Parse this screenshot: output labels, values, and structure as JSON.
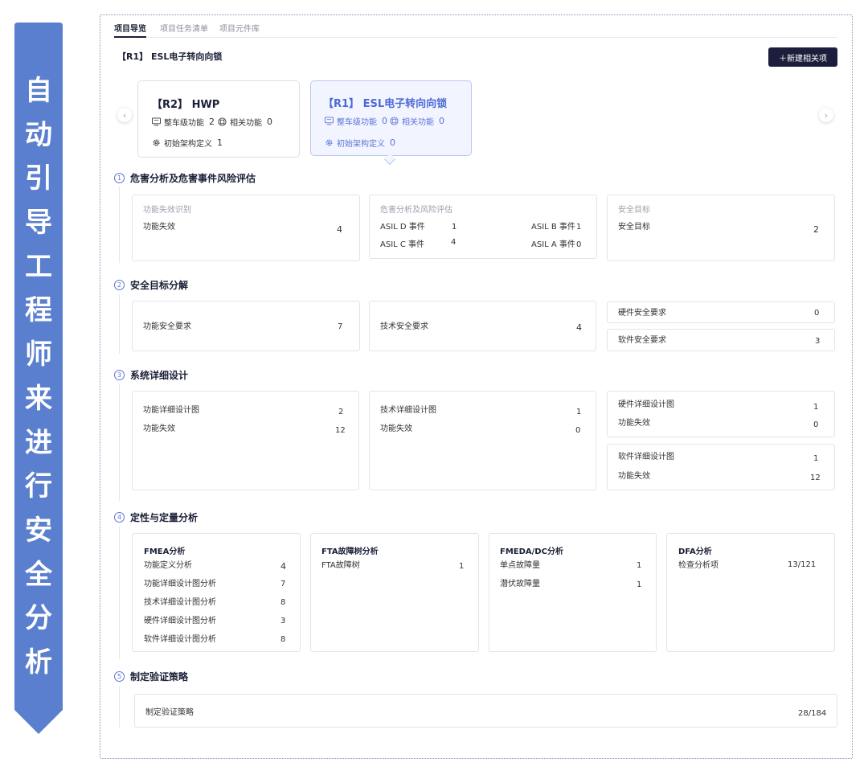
{
  "banner": {
    "chars": [
      "自",
      "动",
      "引",
      "导",
      "工",
      "程",
      "师",
      "来",
      "进",
      "行",
      "安",
      "全",
      "分",
      "析"
    ],
    "color": "#5b7fcf"
  },
  "tabs": [
    {
      "label": "项目导览",
      "active": true
    },
    {
      "label": "项目任务清单",
      "active": false
    },
    {
      "label": "项目元件库",
      "active": false
    }
  ],
  "breadcrumb": "【R1】 ESL电子转向向锁",
  "new_button_label": "＋新建相关项",
  "items": [
    {
      "title": "【R2】 HWP",
      "vehicle_label": "整车级功能",
      "vehicle_count": "2",
      "related_label": "相关功能",
      "related_count": "0",
      "arch_label": "初始架构定义",
      "arch_count": "1",
      "selected": false
    },
    {
      "title": "【R1】 ESL电子转向向锁",
      "vehicle_label": "整车级功能",
      "vehicle_count": "0",
      "related_label": "相关功能",
      "related_count": "0",
      "arch_label": "初始架构定义",
      "arch_count": "0",
      "selected": true
    }
  ],
  "sections": [
    {
      "num": "1",
      "title": "危害分析及危害事件风险评估",
      "cards": {
        "func_fail": {
          "subtitle": "功能失效识别",
          "label": "功能失效",
          "value": "4"
        },
        "hara": {
          "subtitle": "危害分析及风险评估",
          "asil_d_label": "ASIL D 事件",
          "asil_d": "1",
          "asil_b_label": "ASIL B 事件",
          "asil_b": "1",
          "asil_c_label": "ASIL C 事件",
          "asil_c": "4",
          "asil_a_label": "ASIL A 事件",
          "asil_a": "0"
        },
        "safety_goal": {
          "subtitle": "安全目标",
          "label": "安全目标",
          "value": "2"
        }
      }
    },
    {
      "num": "2",
      "title": "安全目标分解",
      "cards": {
        "fsr": {
          "label": "功能安全要求",
          "value": "7"
        },
        "tsr": {
          "label": "技术安全要求",
          "value": "4"
        },
        "hsr": {
          "label": "硬件安全要求",
          "value": "0"
        },
        "ssr": {
          "label": "软件安全要求",
          "value": "3"
        }
      }
    },
    {
      "num": "3",
      "title": "系统详细设计",
      "cards": {
        "func_design": {
          "label1": "功能详细设计图",
          "value1": "2",
          "label2": "功能失效",
          "value2": "12"
        },
        "tech_design": {
          "label1": "技术详细设计图",
          "value1": "1",
          "label2": "功能失效",
          "value2": "0"
        },
        "hw_design": {
          "label1": "硬件详细设计图",
          "value1": "1",
          "label2": "功能失效",
          "value2": "0"
        },
        "sw_design": {
          "label1": "软件详细设计图",
          "value1": "1",
          "label2": "功能失效",
          "value2": "12"
        }
      }
    },
    {
      "num": "4",
      "title": "定性与定量分析",
      "cards": {
        "fmea": {
          "title": "FMEA分析",
          "rows": [
            {
              "label": "功能定义分析",
              "value": "4"
            },
            {
              "label": "功能详细设计图分析",
              "value": "7"
            },
            {
              "label": "技术详细设计图分析",
              "value": "8"
            },
            {
              "label": "硬件详细设计图分析",
              "value": "3"
            },
            {
              "label": "软件详细设计图分析",
              "value": "8"
            }
          ]
        },
        "fta": {
          "title": "FTA故障树分析",
          "rows": [
            {
              "label": "FTA故障树",
              "value": "1"
            }
          ]
        },
        "fmeda": {
          "title": "FMEDA/DC分析",
          "rows": [
            {
              "label": "单点故障量",
              "value": "1"
            },
            {
              "label": "潜伏故障量",
              "value": "1"
            }
          ]
        },
        "dfa": {
          "title": "DFA分析",
          "rows": [
            {
              "label": "检查分析项",
              "value": "13/121"
            }
          ]
        }
      }
    },
    {
      "num": "5",
      "title": "制定验证策略",
      "cards": {
        "verify": {
          "label": "制定验证策略",
          "value": "28/184"
        }
      }
    }
  ]
}
